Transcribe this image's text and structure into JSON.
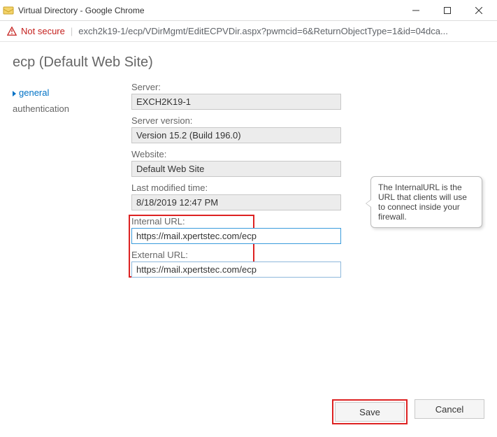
{
  "window": {
    "title": "Virtual Directory - Google Chrome"
  },
  "address": {
    "insecure_label": "Not secure",
    "url": "exch2k19-1/ecp/VDirMgmt/EditECPVDir.aspx?pwmcid=6&ReturnObjectType=1&id=04dca..."
  },
  "page": {
    "heading": "ecp (Default Web Site)"
  },
  "sidebar": {
    "items": [
      {
        "label": "general",
        "active": true
      },
      {
        "label": "authentication",
        "active": false
      }
    ]
  },
  "form": {
    "server_label": "Server:",
    "server_value": "EXCH2K19-1",
    "version_label": "Server version:",
    "version_value": "Version 15.2 (Build 196.0)",
    "website_label": "Website:",
    "website_value": "Default Web Site",
    "modified_label": "Last modified time:",
    "modified_value": "8/18/2019 12:47 PM",
    "internal_label": "Internal URL:",
    "internal_value": "https://mail.xpertstec.com/ecp",
    "external_label": "External URL:",
    "external_value": "https://mail.xpertstec.com/ecp"
  },
  "tooltip": {
    "text": "The InternalURL is the URL that clients will use to connect inside your firewall."
  },
  "buttons": {
    "save": "Save",
    "cancel": "Cancel"
  }
}
